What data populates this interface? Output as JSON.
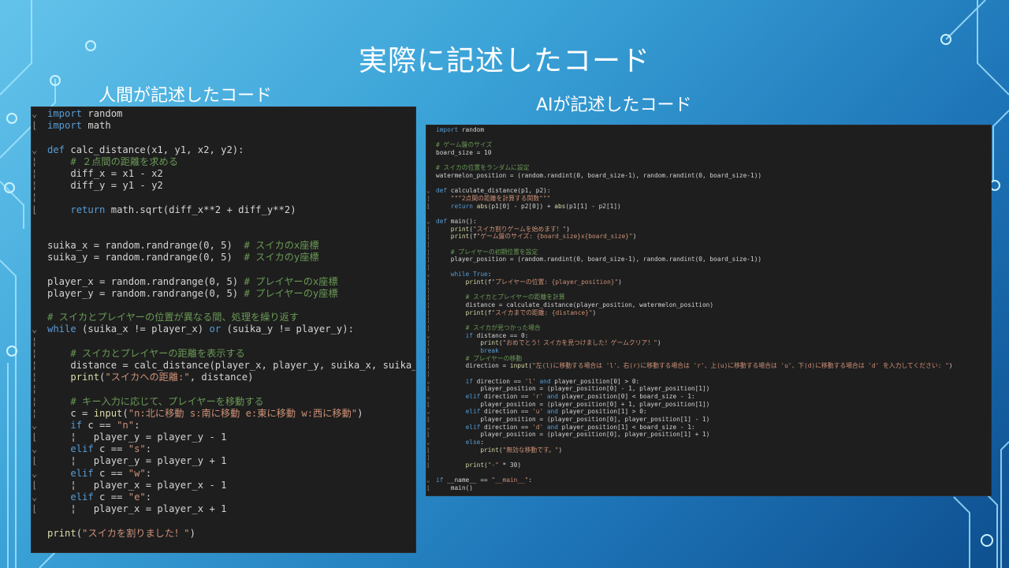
{
  "slide": {
    "title": "実際に記述したコード",
    "left_heading": "人間が記述したコード",
    "right_heading": "AIが記述したコード"
  },
  "colors": {
    "background_light": "#64c3ea",
    "background_dark": "#0e4f8f",
    "editor_bg": "#1e1e1e",
    "keyword": "#569cd6",
    "comment": "#6a9955",
    "string": "#ce9178"
  },
  "human_code": [
    {
      "g": "⌄",
      "t": "import random"
    },
    {
      "g": "⌊",
      "t": "import math"
    },
    {
      "g": "",
      "t": ""
    },
    {
      "g": "⌄",
      "t": "def calc_distance(x1, y1, x2, y2):"
    },
    {
      "g": "¦",
      "t": "    # ２点間の距離を求める"
    },
    {
      "g": "¦",
      "t": "    diff_x = x1 - x2"
    },
    {
      "g": "¦",
      "t": "    diff_y = y1 - y2"
    },
    {
      "g": "¦",
      "t": ""
    },
    {
      "g": "⌊",
      "t": "    return math.sqrt(diff_x**2 + diff_y**2)"
    },
    {
      "g": "",
      "t": ""
    },
    {
      "g": "",
      "t": ""
    },
    {
      "g": "",
      "t": "suika_x = random.randrange(0, 5)  # スイカのx座標"
    },
    {
      "g": "",
      "t": "suika_y = random.randrange(0, 5)  # スイカのy座標"
    },
    {
      "g": "",
      "t": ""
    },
    {
      "g": "",
      "t": "player_x = random.randrange(0, 5) # プレイヤーのx座標"
    },
    {
      "g": "",
      "t": "player_y = random.randrange(0, 5) # プレイヤーのy座標"
    },
    {
      "g": "",
      "t": ""
    },
    {
      "g": "",
      "t": "# スイカとプレイヤーの位置が異なる間、処理を繰り返す"
    },
    {
      "g": "⌄",
      "t": "while (suika_x != player_x) or (suika_y != player_y):"
    },
    {
      "g": "¦",
      "t": ""
    },
    {
      "g": "¦",
      "t": "    # スイカとプレイヤーの距離を表示する"
    },
    {
      "g": "¦",
      "t": "    distance = calc_distance(player_x, player_y, suika_x, suika_y)"
    },
    {
      "g": "¦",
      "t": "    print(\"スイカへの距離:\", distance)"
    },
    {
      "g": "¦",
      "t": ""
    },
    {
      "g": "¦",
      "t": "    # キー入力に応じて、プレイヤーを移動する"
    },
    {
      "g": "¦",
      "t": "    c = input(\"n:北に移動 s:南に移動 e:東に移動 w:西に移動\")"
    },
    {
      "g": "⌄",
      "t": "    if c == \"n\":"
    },
    {
      "g": "⌊",
      "t": "    ¦   player_y = player_y - 1"
    },
    {
      "g": "⌄",
      "t": "    elif c == \"s\":"
    },
    {
      "g": "⌊",
      "t": "    ¦   player_y = player_y + 1"
    },
    {
      "g": "⌄",
      "t": "    elif c == \"w\":"
    },
    {
      "g": "⌊",
      "t": "    ¦   player_x = player_x - 1"
    },
    {
      "g": "⌄",
      "t": "    elif c == \"e\":"
    },
    {
      "g": "⌊",
      "t": "    ¦   player_x = player_x + 1"
    },
    {
      "g": "",
      "t": ""
    },
    {
      "g": "",
      "t": "print(\"スイカを割りました！\")"
    }
  ],
  "ai_code": [
    {
      "g": "",
      "t": "import random"
    },
    {
      "g": "",
      "t": ""
    },
    {
      "g": "",
      "t": "# ゲーム盤のサイズ"
    },
    {
      "g": "",
      "t": "board_size = 10"
    },
    {
      "g": "",
      "t": ""
    },
    {
      "g": "",
      "t": "# スイカの位置をランダムに設定"
    },
    {
      "g": "",
      "t": "watermelon_position = (random.randint(0, board_size-1), random.randint(0, board_size-1))"
    },
    {
      "g": "",
      "t": ""
    },
    {
      "g": "⌄",
      "t": "def calculate_distance(p1, p2):"
    },
    {
      "g": "¦",
      "t": "    \"\"\"2点間の距離を計算する関数\"\"\""
    },
    {
      "g": "⌊",
      "t": "    return abs(p1[0] - p2[0]) + abs(p1[1] - p2[1])"
    },
    {
      "g": "",
      "t": ""
    },
    {
      "g": "⌄",
      "t": "def main():"
    },
    {
      "g": "¦",
      "t": "    print(\"スイカ割りゲームを始めます！\")"
    },
    {
      "g": "¦",
      "t": "    print(f\"ゲーム盤のサイズ: {board_size}x{board_size}\")"
    },
    {
      "g": "¦",
      "t": ""
    },
    {
      "g": "¦",
      "t": "    # プレイヤーの初期位置を設定"
    },
    {
      "g": "¦",
      "t": "    player_position = (random.randint(0, board_size-1), random.randint(0, board_size-1))"
    },
    {
      "g": "¦",
      "t": ""
    },
    {
      "g": "⌄",
      "t": "    while True:"
    },
    {
      "g": "¦",
      "t": "        print(f\"プレイヤーの位置: {player_position}\")"
    },
    {
      "g": "¦",
      "t": ""
    },
    {
      "g": "¦",
      "t": "        # スイカとプレイヤーの距離を計算"
    },
    {
      "g": "¦",
      "t": "        distance = calculate_distance(player_position, watermelon_position)"
    },
    {
      "g": "¦",
      "t": "        print(f\"スイカまでの距離: {distance}\")"
    },
    {
      "g": "¦",
      "t": ""
    },
    {
      "g": "¦",
      "t": "        # スイカが見つかった場合"
    },
    {
      "g": "⌄",
      "t": "        if distance == 0:"
    },
    {
      "g": "¦",
      "t": "            print(\"おめでとう！スイカを見つけました！ゲームクリア！\")"
    },
    {
      "g": "⌊",
      "t": "            break"
    },
    {
      "g": "¦",
      "t": "        # プレイヤーの移動"
    },
    {
      "g": "¦",
      "t": "        direction = input(\"左(l)に移動する場合は 'l'、右(r)に移動する場合は 'r'、上(u)に移動する場合は 'u'、下(d)に移動する場合は 'd' を入力してください: \")"
    },
    {
      "g": "¦",
      "t": ""
    },
    {
      "g": "⌄",
      "t": "        if direction == 'l' and player_position[0] > 0:"
    },
    {
      "g": "⌊",
      "t": "            player_position = (player_position[0] - 1, player_position[1])"
    },
    {
      "g": "⌄",
      "t": "        elif direction == 'r' and player_position[0] < board_size - 1:"
    },
    {
      "g": "⌊",
      "t": "            player_position = (player_position[0] + 1, player_position[1])"
    },
    {
      "g": "⌄",
      "t": "        elif direction == 'u' and player_position[1] > 0:"
    },
    {
      "g": "⌊",
      "t": "            player_position = (player_position[0], player_position[1] - 1)"
    },
    {
      "g": "⌄",
      "t": "        elif direction == 'd' and player_position[1] < board_size - 1:"
    },
    {
      "g": "⌊",
      "t": "            player_position = (player_position[0], player_position[1] + 1)"
    },
    {
      "g": "⌄",
      "t": "        else:"
    },
    {
      "g": "⌊",
      "t": "            print(\"無効な移動です。\")"
    },
    {
      "g": "¦",
      "t": ""
    },
    {
      "g": "⌊",
      "t": "        print(\"-\" * 30)"
    },
    {
      "g": "",
      "t": ""
    },
    {
      "g": "⌄",
      "t": "if __name__ == \"__main__\":"
    },
    {
      "g": "⌊",
      "t": "    main()"
    }
  ]
}
